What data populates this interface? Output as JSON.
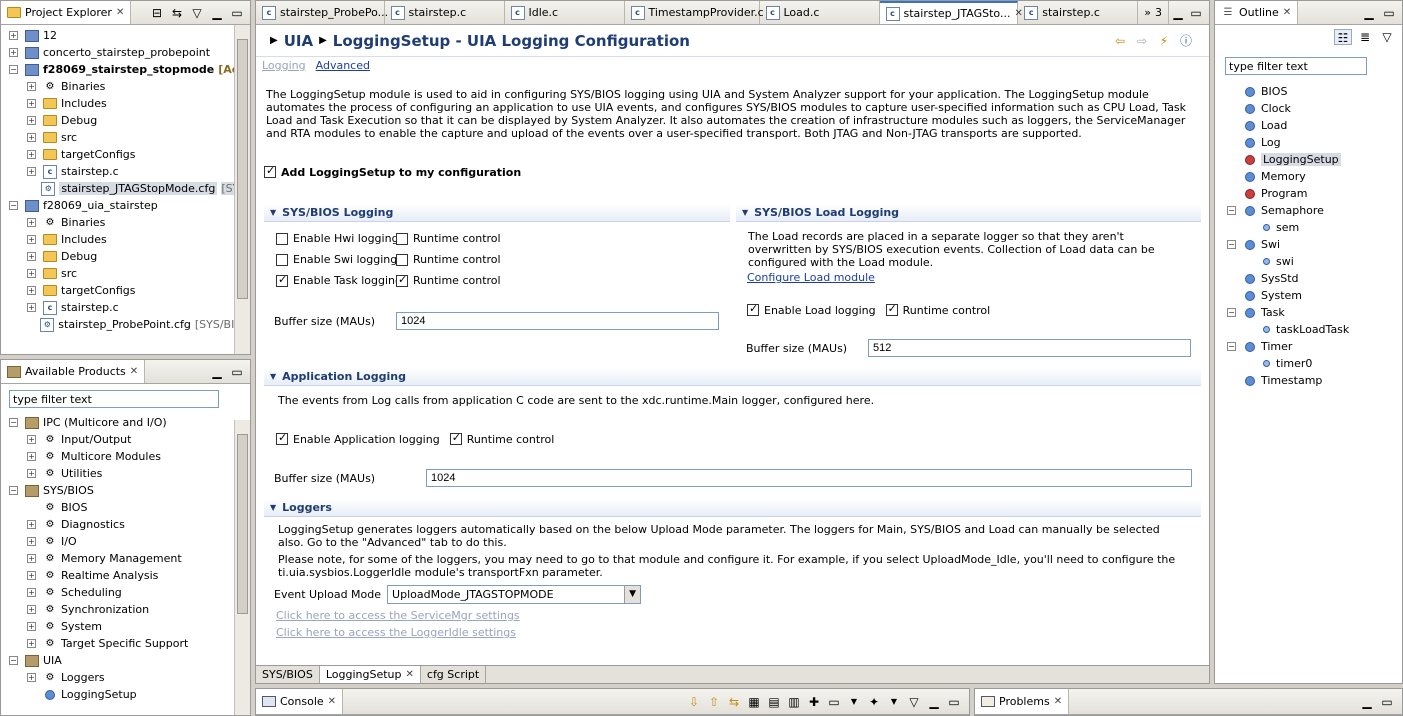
{
  "project_explorer": {
    "tab_label": "Project Explorer",
    "items": [
      {
        "indent": 0,
        "expander": "+",
        "icon": "project",
        "label": "12",
        "extra": ""
      },
      {
        "indent": 0,
        "expander": "+",
        "icon": "project",
        "label": "concerto_stairstep_probepoint",
        "extra": ""
      },
      {
        "indent": 0,
        "expander": "−",
        "icon": "project",
        "label": "f28069_stairstep_stopmode",
        "extra": "[Ac",
        "bold": true
      },
      {
        "indent": 1,
        "expander": "+",
        "icon": "binary",
        "label": "Binaries",
        "extra": ""
      },
      {
        "indent": 1,
        "expander": "+",
        "icon": "folder",
        "label": "Includes",
        "extra": ""
      },
      {
        "indent": 1,
        "expander": "+",
        "icon": "folder",
        "label": "Debug",
        "extra": ""
      },
      {
        "indent": 1,
        "expander": "+",
        "icon": "folder",
        "label": "src",
        "extra": ""
      },
      {
        "indent": 1,
        "expander": "+",
        "icon": "folder",
        "label": "targetConfigs",
        "extra": ""
      },
      {
        "indent": 1,
        "expander": "+",
        "icon": "file",
        "label": "stairstep.c",
        "extra": ""
      },
      {
        "indent": 1,
        "expander": "",
        "icon": "cfg",
        "label": "stairstep_JTAGStopMode.cfg",
        "extra": "[SYS/",
        "selected": true
      },
      {
        "indent": 0,
        "expander": "−",
        "icon": "project",
        "label": "f28069_uia_stairstep",
        "extra": ""
      },
      {
        "indent": 1,
        "expander": "+",
        "icon": "binary",
        "label": "Binaries",
        "extra": ""
      },
      {
        "indent": 1,
        "expander": "+",
        "icon": "folder",
        "label": "Includes",
        "extra": ""
      },
      {
        "indent": 1,
        "expander": "+",
        "icon": "folder",
        "label": "Debug",
        "extra": ""
      },
      {
        "indent": 1,
        "expander": "+",
        "icon": "folder",
        "label": "src",
        "extra": ""
      },
      {
        "indent": 1,
        "expander": "+",
        "icon": "folder",
        "label": "targetConfigs",
        "extra": ""
      },
      {
        "indent": 1,
        "expander": "+",
        "icon": "file",
        "label": "stairstep.c",
        "extra": ""
      },
      {
        "indent": 1,
        "expander": "",
        "icon": "cfg",
        "label": "stairstep_ProbePoint.cfg",
        "extra": "[SYS/BIOS"
      }
    ]
  },
  "available_products": {
    "tab_label": "Available Products",
    "filter_value": "type filter text",
    "items": [
      {
        "indent": 0,
        "expander": "−",
        "icon": "pkg",
        "label": "IPC (Multicore and I/O)"
      },
      {
        "indent": 1,
        "expander": "+",
        "icon": "module",
        "label": "Input/Output"
      },
      {
        "indent": 1,
        "expander": "+",
        "icon": "module",
        "label": "Multicore Modules"
      },
      {
        "indent": 1,
        "expander": "+",
        "icon": "module",
        "label": "Utilities"
      },
      {
        "indent": 0,
        "expander": "−",
        "icon": "pkg",
        "label": "SYS/BIOS"
      },
      {
        "indent": 1,
        "expander": "",
        "icon": "module",
        "label": "BIOS"
      },
      {
        "indent": 1,
        "expander": "+",
        "icon": "module",
        "label": "Diagnostics"
      },
      {
        "indent": 1,
        "expander": "+",
        "icon": "module",
        "label": "I/O"
      },
      {
        "indent": 1,
        "expander": "+",
        "icon": "module",
        "label": "Memory Management"
      },
      {
        "indent": 1,
        "expander": "+",
        "icon": "module",
        "label": "Realtime Analysis"
      },
      {
        "indent": 1,
        "expander": "+",
        "icon": "module",
        "label": "Scheduling"
      },
      {
        "indent": 1,
        "expander": "+",
        "icon": "module",
        "label": "Synchronization"
      },
      {
        "indent": 1,
        "expander": "+",
        "icon": "module",
        "label": "System"
      },
      {
        "indent": 1,
        "expander": "+",
        "icon": "module",
        "label": "Target Specific Support"
      },
      {
        "indent": 0,
        "expander": "−",
        "icon": "pkg",
        "label": "UIA"
      },
      {
        "indent": 1,
        "expander": "+",
        "icon": "module",
        "label": "Loggers"
      },
      {
        "indent": 1,
        "expander": "",
        "icon": "globe",
        "label": "LoggingSetup"
      }
    ]
  },
  "editor_tabs": [
    {
      "label": "stairstep_ProbePo...",
      "active": false
    },
    {
      "label": "stairstep.c",
      "active": false
    },
    {
      "label": "Idle.c",
      "active": false
    },
    {
      "label": "TimestampProvider.c",
      "active": false
    },
    {
      "label": "Load.c",
      "active": false
    },
    {
      "label": "stairstep_JTAGSto...",
      "active": true
    },
    {
      "label": "stairstep.c",
      "active": false
    }
  ],
  "editor_tab_overflow": "3",
  "editor": {
    "breadcrumb_root": "UIA",
    "title": "LoggingSetup - UIA Logging Configuration",
    "subtabs": {
      "logging": "Logging",
      "advanced": "Advanced"
    },
    "description": "The LoggingSetup module is used to aid in configuring SYS/BIOS logging using UIA and System Analyzer support for your application. The LoggingSetup module automates the process of configuring an application to use UIA events, and configures SYS/BIOS modules to capture user-specified information such as CPU Load, Task Load and Task Execution so that it can be displayed by System Analyzer. It also automates the creation of infrastructure modules such as loggers, the ServiceManager and RTA modules to enable the capture and upload of the events over a user-specified transport. Both JTAG and Non-JTAG transports are supported.",
    "add_logging_setup": "Add LoggingSetup to my configuration",
    "sysbios_logging": {
      "title": "SYS/BIOS Logging",
      "rows": [
        {
          "left": "Enable Hwi logging",
          "left_on": false,
          "right": "Runtime control",
          "right_on": false
        },
        {
          "left": "Enable Swi logging",
          "left_on": false,
          "right": "Runtime control",
          "right_on": false
        },
        {
          "left": "Enable Task logging",
          "left_on": true,
          "right": "Runtime control",
          "right_on": true
        }
      ],
      "buffer_label": "Buffer size (MAUs)",
      "buffer_value": "1024"
    },
    "load_logging": {
      "title": "SYS/BIOS Load Logging",
      "description": "The Load records are placed in a separate logger so that they aren't overwritten by SYS/BIOS execution events. Collection of Load data can be configured with the Load module.",
      "configure_link": "Configure Load module",
      "enable_label": "Enable Load logging",
      "runtime_label": "Runtime control",
      "buffer_label": "Buffer size (MAUs)",
      "buffer_value": "512"
    },
    "app_logging": {
      "title": "Application Logging",
      "description": "The events from Log calls from application C code are sent to the xdc.runtime.Main logger, configured here.",
      "enable_label": "Enable Application logging",
      "runtime_label": "Runtime control",
      "buffer_label": "Buffer size (MAUs)",
      "buffer_value": "1024"
    },
    "loggers": {
      "title": "Loggers",
      "description1": "LoggingSetup generates loggers automatically based on the below Upload Mode parameter. The loggers for Main, SYS/BIOS and Load can manually be selected also. Go to the \"Advanced\" tab to do this.",
      "description2": "Please note, for some of the loggers, you may need to go to that module and configure it. For example, if you select UploadMode_Idle, you'll need to configure the ti.uia.sysbios.LoggerIdle module's transportFxn parameter.",
      "upload_label": "Event Upload Mode",
      "upload_value": "UploadMode_JTAGSTOPMODE",
      "link_servicemgr": "Click here to access the ServiceMgr settings",
      "link_loggeridle": "Click here to access the LoggerIdle settings"
    },
    "bottom_tabs": [
      {
        "label": "SYS/BIOS",
        "active": false
      },
      {
        "label": "LoggingSetup",
        "active": true
      },
      {
        "label": "cfg Script",
        "active": false
      }
    ]
  },
  "outline": {
    "tab_label": "Outline",
    "filter_value": "type filter text",
    "items": [
      {
        "indent": 0,
        "expander": "",
        "color": "blue",
        "label": "BIOS"
      },
      {
        "indent": 0,
        "expander": "",
        "color": "blue",
        "label": "Clock"
      },
      {
        "indent": 0,
        "expander": "",
        "color": "blue",
        "label": "Load"
      },
      {
        "indent": 0,
        "expander": "",
        "color": "blue",
        "label": "Log"
      },
      {
        "indent": 0,
        "expander": "",
        "color": "red",
        "label": "LoggingSetup",
        "selected": true
      },
      {
        "indent": 0,
        "expander": "",
        "color": "blue",
        "label": "Memory"
      },
      {
        "indent": 0,
        "expander": "",
        "color": "red",
        "label": "Program"
      },
      {
        "indent": 0,
        "expander": "−",
        "color": "blue",
        "label": "Semaphore"
      },
      {
        "indent": 1,
        "expander": "",
        "color": "small",
        "label": "sem"
      },
      {
        "indent": 0,
        "expander": "−",
        "color": "blue",
        "label": "Swi"
      },
      {
        "indent": 1,
        "expander": "",
        "color": "small",
        "label": "swi"
      },
      {
        "indent": 0,
        "expander": "",
        "color": "blue",
        "label": "SysStd"
      },
      {
        "indent": 0,
        "expander": "",
        "color": "blue",
        "label": "System"
      },
      {
        "indent": 0,
        "expander": "−",
        "color": "blue",
        "label": "Task"
      },
      {
        "indent": 1,
        "expander": "",
        "color": "small",
        "label": "taskLoadTask"
      },
      {
        "indent": 0,
        "expander": "−",
        "color": "blue",
        "label": "Timer"
      },
      {
        "indent": 1,
        "expander": "",
        "color": "small",
        "label": "timer0"
      },
      {
        "indent": 0,
        "expander": "",
        "color": "blue",
        "label": "Timestamp"
      }
    ]
  },
  "console": {
    "tab_label": "Console"
  },
  "problems": {
    "tab_label": "Problems"
  },
  "colors": {
    "accent": "#3b73c4",
    "section_title": "#1f3c73",
    "link": "#1c3ea6"
  }
}
